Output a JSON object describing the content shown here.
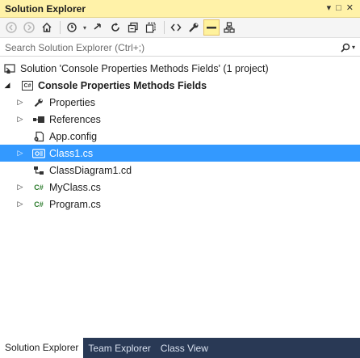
{
  "title_bar": {
    "title": "Solution Explorer",
    "pin_icon": "▾",
    "close_icon": "✕"
  },
  "toolbar": {
    "buttons": [
      "back-icon",
      "forward-icon",
      "home-icon",
      "history-icon",
      "sync-icon",
      "refresh-icon",
      "collapse-all-icon",
      "show-all-files-icon",
      "code-view-icon",
      "properties-icon",
      "preview-icon",
      "class-diagram-icon"
    ]
  },
  "search": {
    "placeholder": "Search Solution Explorer (Ctrl+;)"
  },
  "tree": {
    "solution_label": "Solution 'Console Properties Methods Fields' (1 project)",
    "project_label": "Console Properties Methods Fields",
    "items": [
      {
        "label": "Properties"
      },
      {
        "label": "References"
      },
      {
        "label": "App.config"
      },
      {
        "label": "Class1.cs"
      },
      {
        "label": "ClassDiagram1.cd"
      },
      {
        "label": "MyClass.cs"
      },
      {
        "label": "Program.cs"
      }
    ]
  },
  "bottom_tabs": [
    {
      "label": "Solution Explorer"
    },
    {
      "label": "Team Explorer"
    },
    {
      "label": "Class View"
    }
  ],
  "colors": {
    "title_bg": "#fff2a8",
    "selection": "#3399ff",
    "tab_strip": "#293955"
  }
}
